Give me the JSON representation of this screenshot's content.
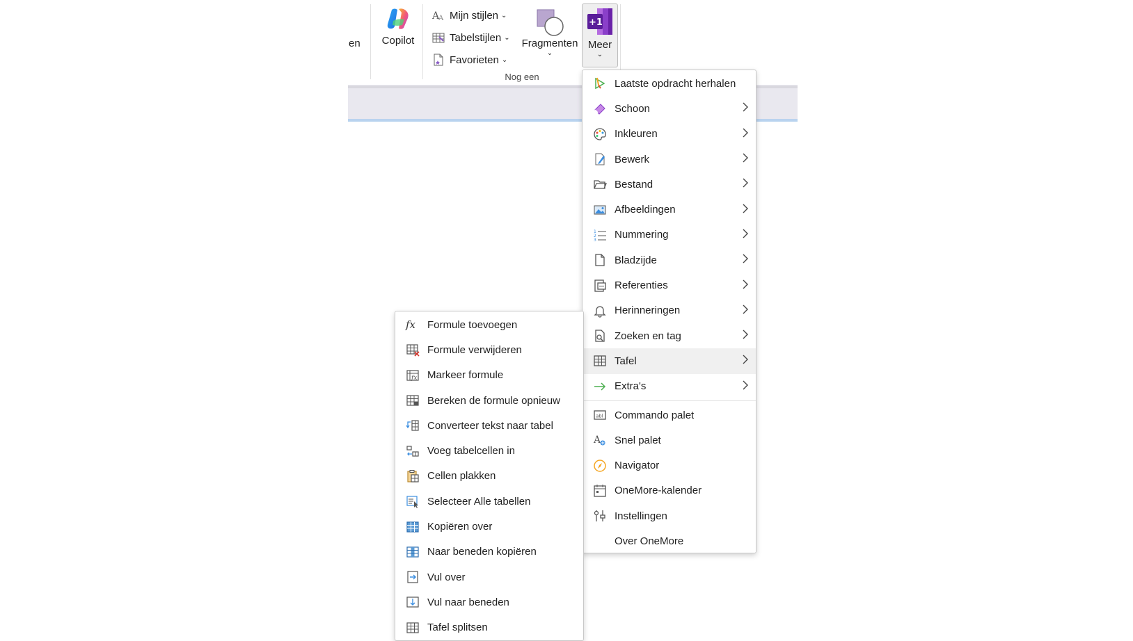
{
  "ribbon": {
    "cut_label": "en",
    "copilot_label": "Copilot",
    "styles": [
      {
        "label": "Mijn stijlen",
        "icon": "text-style-icon"
      },
      {
        "label": "Tabelstijlen",
        "icon": "table-style-icon"
      },
      {
        "label": "Favorieten",
        "icon": "favorites-icon"
      }
    ],
    "fragmenten_label": "Fragmenten",
    "meer_label": "Meer",
    "group_label": "Nog een"
  },
  "main_menu": {
    "items": [
      {
        "label": "Laatste opdracht herhalen",
        "icon": "repeat-icon",
        "submenu": false
      },
      {
        "label": "Schoon",
        "icon": "eraser-icon",
        "submenu": true
      },
      {
        "label": "Inkleuren",
        "icon": "palette-icon",
        "submenu": true
      },
      {
        "label": "Bewerk",
        "icon": "edit-icon",
        "submenu": true
      },
      {
        "label": "Bestand",
        "icon": "folder-icon",
        "submenu": true
      },
      {
        "label": "Afbeeldingen",
        "icon": "image-icon",
        "submenu": true
      },
      {
        "label": "Nummering",
        "icon": "numbering-icon",
        "submenu": true
      },
      {
        "label": "Bladzijde",
        "icon": "page-icon",
        "submenu": true
      },
      {
        "label": "Referenties",
        "icon": "references-icon",
        "submenu": true
      },
      {
        "label": "Herinneringen",
        "icon": "bell-icon",
        "submenu": true
      },
      {
        "label": "Zoeken en tag",
        "icon": "search-tag-icon",
        "submenu": true
      },
      {
        "label": "Tafel",
        "icon": "table-icon",
        "submenu": true
      },
      {
        "label": "Extra's",
        "icon": "arrow-right-icon",
        "submenu": true
      }
    ],
    "bottom_items": [
      {
        "label": "Commando palet",
        "icon": "command-palette-icon"
      },
      {
        "label": "Snel palet",
        "icon": "quick-palette-icon"
      },
      {
        "label": "Navigator",
        "icon": "navigator-icon"
      },
      {
        "label": "OneMore-kalender",
        "icon": "calendar-icon"
      },
      {
        "label": "Instellingen",
        "icon": "settings-icon"
      },
      {
        "label": "Over OneMore",
        "icon": ""
      }
    ]
  },
  "sub_menu": {
    "items": [
      {
        "label": "Formule toevoegen",
        "icon": "formula-icon"
      },
      {
        "label": "Formule verwijderen",
        "icon": "table-delete-icon"
      },
      {
        "label": "Markeer formule",
        "icon": "table-formula-icon"
      },
      {
        "label": "Bereken de formule opnieuw",
        "icon": "table-recalc-icon"
      },
      {
        "label": "Converteer tekst naar tabel",
        "icon": "convert-table-icon"
      },
      {
        "label": "Voeg tabelcellen in",
        "icon": "insert-cells-icon"
      },
      {
        "label": "Cellen plakken",
        "icon": "paste-cells-icon"
      },
      {
        "label": "Selecteer Alle tabellen",
        "icon": "select-tables-icon"
      },
      {
        "label": "Kopiëren over",
        "icon": "copy-across-icon"
      },
      {
        "label": "Naar beneden kopiëren",
        "icon": "copy-down-icon"
      },
      {
        "label": "Vul over",
        "icon": "fill-across-icon"
      },
      {
        "label": "Vul naar beneden",
        "icon": "fill-down-icon"
      },
      {
        "label": "Tafel splitsen",
        "icon": "split-table-icon"
      }
    ]
  }
}
